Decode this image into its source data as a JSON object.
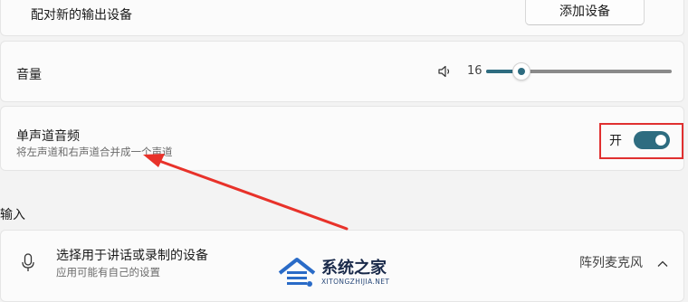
{
  "output": {
    "pair_label": "配对新的输出设备",
    "pair_button": "添加设备"
  },
  "volume": {
    "label": "音量",
    "value_text": "16",
    "level_percent": 16
  },
  "mono_audio": {
    "title": "单声道音频",
    "description": "将左声道和右声道合并成一个声道",
    "state_text": "开",
    "on": true
  },
  "input_section": {
    "heading": "输入",
    "device_prompt": "选择用于讲话或录制的设备",
    "device_hint": "应用可能有自己的设置",
    "selected_device": "阵列麦克风"
  },
  "watermark": {
    "title": "系统之家",
    "subtitle": "XITONGZHIJIA.NET"
  },
  "colors": {
    "accent": "#2e6c80",
    "highlight_box": "#e03030",
    "arrow": "#e8322a"
  },
  "icons": {
    "speaker": "speaker-icon",
    "mic": "microphone-icon",
    "expand": "chevron-up-icon"
  }
}
